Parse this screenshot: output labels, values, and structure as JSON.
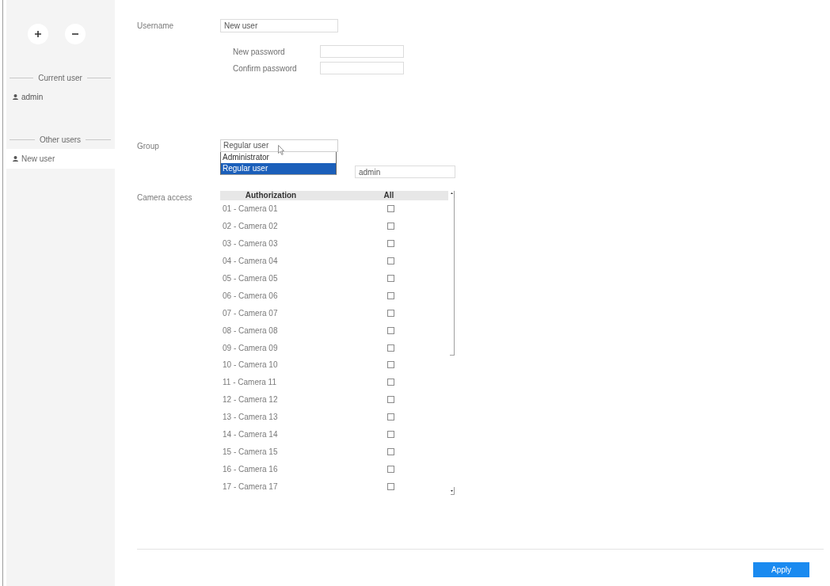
{
  "sidebar": {
    "sections": [
      {
        "title": "Current user",
        "users": [
          {
            "name": "admin",
            "selected": false
          }
        ]
      },
      {
        "title": "Other users",
        "users": [
          {
            "name": "New user",
            "selected": true
          }
        ]
      }
    ]
  },
  "form": {
    "username": {
      "label": "Username",
      "value": "New user"
    },
    "passwords": [
      {
        "label": "New password"
      },
      {
        "label": "Confirm password"
      }
    ],
    "group": {
      "label": "Group",
      "value": "Regular user",
      "expanded": true,
      "options": [
        {
          "label": "Administrator",
          "selected": false
        },
        {
          "label": "Regular user",
          "selected": true
        }
      ]
    },
    "covered_field": {
      "value": "admin"
    },
    "camera_access": {
      "label": "Camera access",
      "columns": [
        "Authorization",
        "All"
      ],
      "rows": [
        {
          "name": "01 - Camera 01",
          "checked": false
        },
        {
          "name": "02 - Camera 02",
          "checked": false
        },
        {
          "name": "03 - Camera 03",
          "checked": false
        },
        {
          "name": "04 - Camera 04",
          "checked": false
        },
        {
          "name": "05 - Camera 05",
          "checked": false
        },
        {
          "name": "06 - Camera 06",
          "checked": false
        },
        {
          "name": "07 - Camera 07",
          "checked": false
        },
        {
          "name": "08 - Camera 08",
          "checked": false
        },
        {
          "name": "09 - Camera 09",
          "checked": false
        },
        {
          "name": "10 - Camera 10",
          "checked": false
        },
        {
          "name": "11 - Camera 11",
          "checked": false
        },
        {
          "name": "12 - Camera 12",
          "checked": false
        },
        {
          "name": "13 - Camera 13",
          "checked": false
        },
        {
          "name": "14 - Camera 14",
          "checked": false
        },
        {
          "name": "15 - Camera 15",
          "checked": false
        },
        {
          "name": "16 - Camera 16",
          "checked": false
        },
        {
          "name": "17 - Camera 17",
          "checked": false
        }
      ]
    }
  },
  "apply_button": "Apply"
}
